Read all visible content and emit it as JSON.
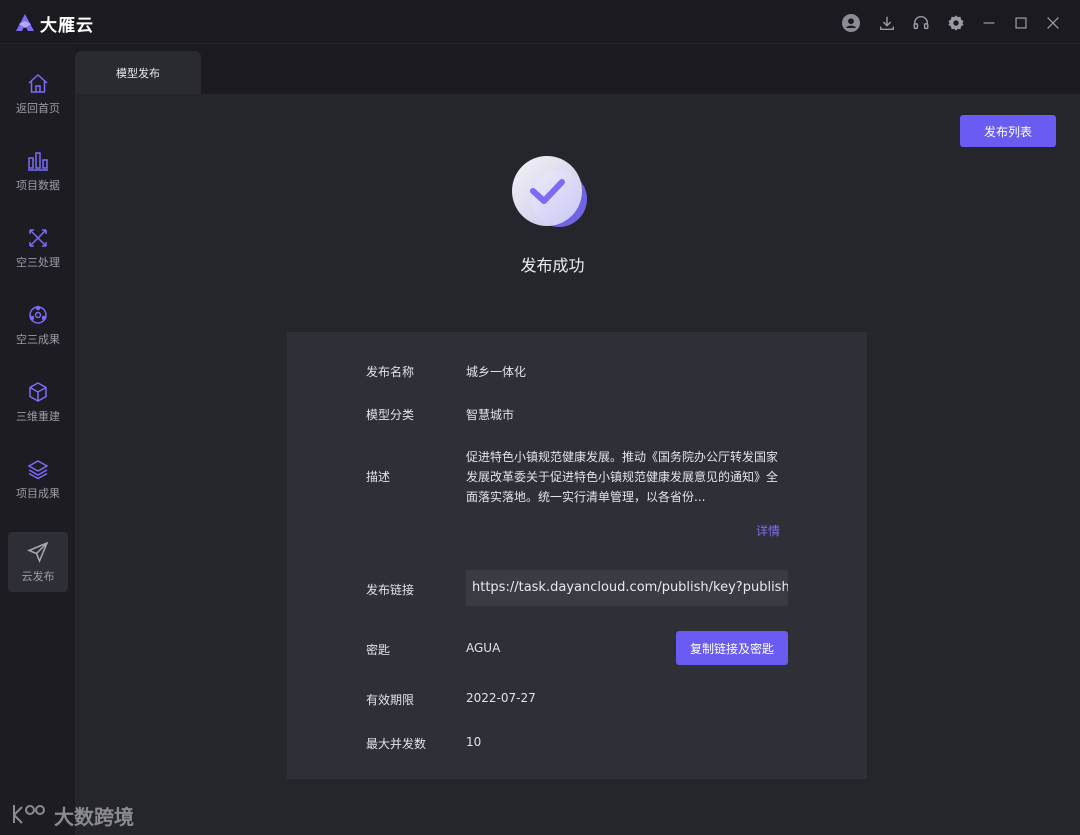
{
  "app": {
    "name": "大雁云"
  },
  "window_controls": [
    "user-icon",
    "download-icon",
    "headset-icon",
    "gear-icon",
    "minimize-icon",
    "maximize-icon",
    "close-icon"
  ],
  "sidebar": {
    "items": [
      {
        "label": "返回首页",
        "icon": "home-icon",
        "active": false
      },
      {
        "label": "项目数据",
        "icon": "bar-chart-icon",
        "active": false
      },
      {
        "label": "空三处理",
        "icon": "process-icon",
        "active": false
      },
      {
        "label": "空三成果",
        "icon": "result-icon",
        "active": false
      },
      {
        "label": "三维重建",
        "icon": "cube-icon",
        "active": false
      },
      {
        "label": "项目成果",
        "icon": "layers-icon",
        "active": false
      },
      {
        "label": "云发布",
        "icon": "send-icon",
        "active": true
      }
    ]
  },
  "tabs": [
    {
      "label": "模型发布",
      "active": true
    }
  ],
  "main": {
    "publish_list_button": "发布列表",
    "success_title": "发布成功",
    "details": {
      "name_label": "发布名称",
      "name_value": "城乡一体化",
      "category_label": "模型分类",
      "category_value": "智慧城市",
      "description_label": "描述",
      "description_value": "促进特色小镇规范健康发展。推动《国务院办公厅转发国家发展改革委关于促进特色小镇规范健康发展意见的通知》全面落实落地。统一实行清单管理，以各省份...",
      "details_link": "详情",
      "link_label": "发布链接",
      "link_value": "https://task.dayancloud.com/publish/key?publishC",
      "key_label": "密匙",
      "key_value": "AGUA",
      "copy_button": "复制链接及密匙",
      "expiry_label": "有效期限",
      "expiry_value": "2022-07-27",
      "concurrency_label": "最大并发数",
      "concurrency_value": "10"
    }
  },
  "watermark": {
    "text": "大数跨境"
  },
  "colors": {
    "accent": "#6a5cf2",
    "link": "#7f6ff5",
    "background": "#1c1c22",
    "panel": "#2f2f37"
  }
}
